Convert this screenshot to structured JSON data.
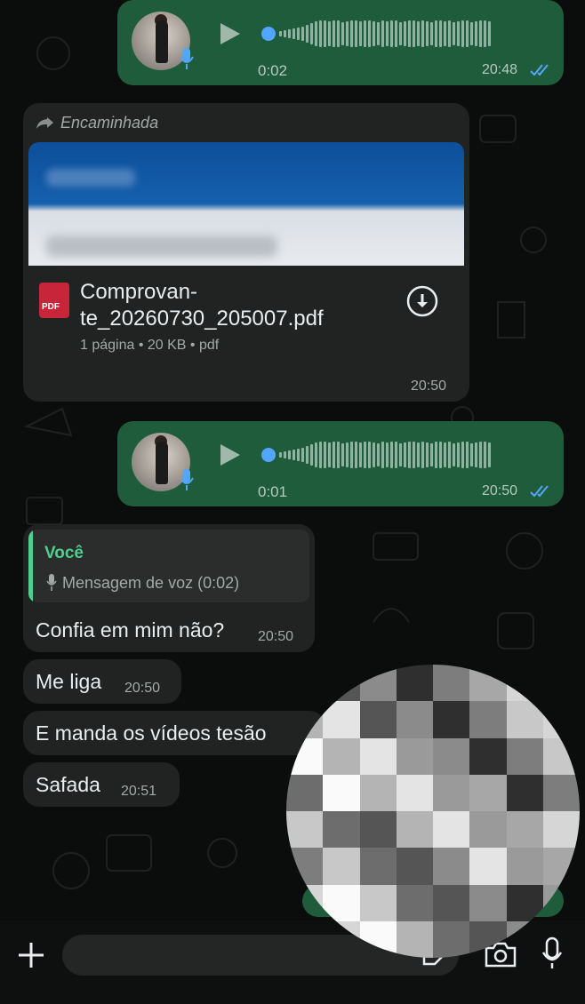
{
  "voice1": {
    "duration": "0:02",
    "time": "20:48"
  },
  "document": {
    "forwarded_label": "Encaminhada",
    "filename_line1": "Comprovan-",
    "filename_line2": "te_20260730_205007.pdf",
    "file_meta": "1 página • 20 KB • pdf",
    "pdf_badge": "PDF",
    "time": "20:50"
  },
  "voice2": {
    "duration": "0:01",
    "time": "20:50"
  },
  "reply": {
    "quote_author": "Você",
    "quote_text": "Mensagem de voz (0:02)",
    "text": "Confia em mim não?",
    "time": "20:50"
  },
  "messages": [
    {
      "text": "Me liga",
      "time": "20:50"
    },
    {
      "text": "E manda os vídeos tesão",
      "time": ""
    },
    {
      "text": "Safada",
      "time": "20:51"
    }
  ],
  "colors": {
    "outgoing": "#1f5c3b",
    "incoming": "#202322",
    "read_ticks": "#53a6ff",
    "quote_accent": "#4fcf8f"
  },
  "icons": [
    "play-icon",
    "mic-icon",
    "download-icon",
    "forward-icon",
    "plus-icon",
    "camera-icon",
    "sticker-icon"
  ]
}
